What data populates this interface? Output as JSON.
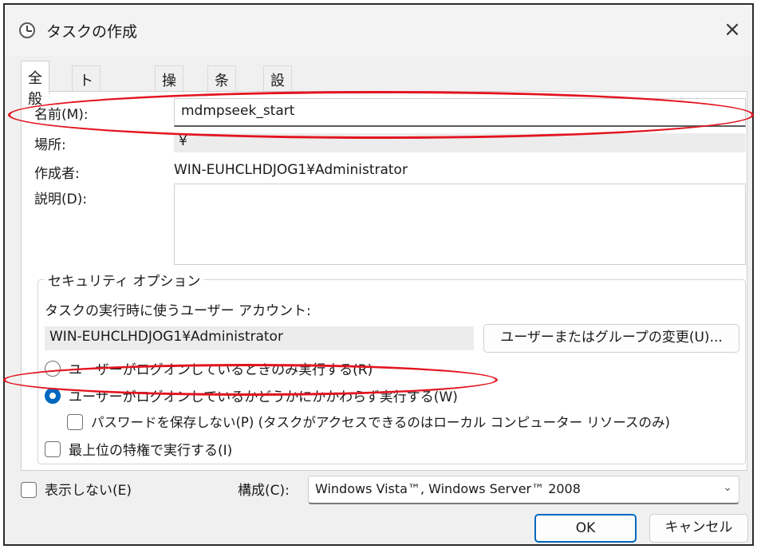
{
  "window": {
    "title": "タスクの作成",
    "close_label": "×"
  },
  "tabs": [
    "全般",
    "トリガー",
    "操作",
    "条件",
    "設定"
  ],
  "general": {
    "name_label": "名前(M):",
    "name_value": "mdmpseek_start",
    "location_label": "場所:",
    "location_value": "¥",
    "author_label": "作成者:",
    "author_value": "WIN-EUHCLHDJOG1¥Administrator",
    "description_label": "説明(D):",
    "description_value": ""
  },
  "security": {
    "group_title": "セキュリティ オプション",
    "account_caption": "タスクの実行時に使うユーザー アカウント:",
    "account_value": "WIN-EUHCLHDJOG1¥Administrator",
    "change_button": "ユーザーまたはグループの変更(U)...",
    "radio_logged_on_only": "ユーザーがログオンしているときのみ実行する(R)",
    "radio_regardless": "ユーザーがログオンしているかどうかにかかわらず実行する(W)",
    "selected_radio": "regardless",
    "no_store_password": "パスワードを保存しない(P) (タスクがアクセスできるのはローカル コンピューター リソースのみ)",
    "highest_privileges": "最上位の特権で実行する(I)"
  },
  "footer": {
    "hidden_label": "表示しない(E)",
    "configure_label": "構成(C):",
    "configure_value": "Windows Vista™, Windows Server™ 2008",
    "ok_button": "OK",
    "cancel_button": "キャンセル"
  },
  "colors": {
    "accent": "#0067c0",
    "highlight": "#e3141f"
  },
  "icons": [
    "clock-icon",
    "close-icon",
    "chevron-down-icon"
  ]
}
